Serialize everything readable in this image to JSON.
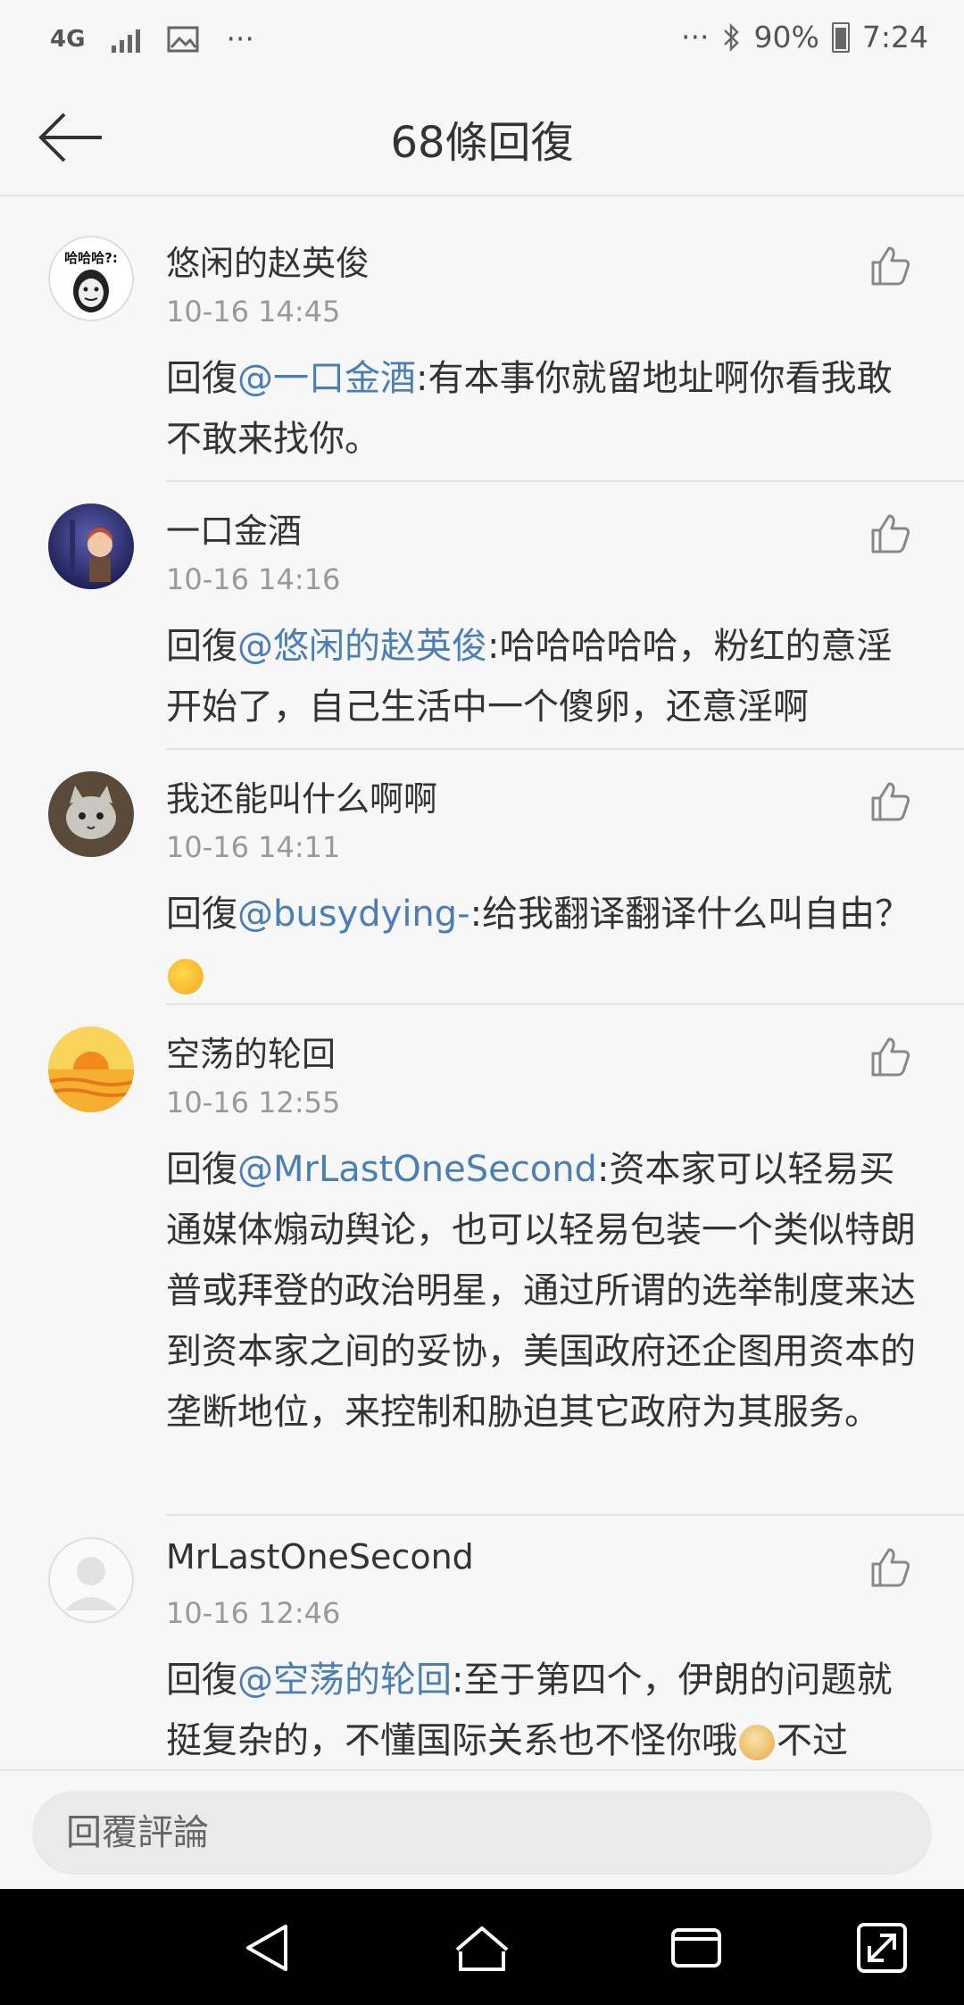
{
  "status_bar": {
    "network": "4G",
    "overflow": "···",
    "overflow_right": "···",
    "battery": "90%",
    "time": "7:24"
  },
  "header": {
    "title": "68條回復"
  },
  "reply_prefix": "回復",
  "comments": [
    {
      "username": "悠闲的赵英俊",
      "time": "10-16 14:45",
      "mention": "@一口金酒",
      "text": ":有本事你就留地址啊你看我敢不敢来找你。",
      "avatar_text": "哈哈哈?:"
    },
    {
      "username": "一口金酒",
      "time": "10-16 14:16",
      "mention": "@悠闲的赵英俊",
      "text": ":哈哈哈哈哈，粉红的意淫开始了，自己生活中一个傻卵，还意淫啊"
    },
    {
      "username": "我还能叫什么啊啊",
      "time": "10-16 14:11",
      "mention": "@busydying-",
      "text": ":给我翻译翻译什么叫自由？"
    },
    {
      "username": "空荡的轮回",
      "time": "10-16 12:55",
      "mention": "@MrLastOneSecond",
      "text": ":资本家可以轻易买通媒体煽动舆论，也可以轻易包装一个类似特朗普或拜登的政治明星，通过所谓的选举制度来达到资本家之间的妥协，美国政府还企图用资本的垄断地位，来控制和胁迫其它政府为其服务。"
    },
    {
      "username": "MrLastOneSecond",
      "time": "10-16 12:46",
      "mention": "@空荡的轮回",
      "text_a": ":至于第四个，伊朗的问题就挺复杂的，不懂国际关系也不怪你哦",
      "text_b": "不过"
    }
  ],
  "input": {
    "placeholder": "回覆評論"
  },
  "colors": {
    "mention": "#4a7eb7",
    "timestamp": "#999999",
    "nav_background": "#000000"
  },
  "icons": {
    "back": "arrow-left-icon",
    "like": "thumbs-up-icon",
    "nav_back": "triangle-back-icon",
    "nav_home": "home-icon",
    "nav_recents": "recents-icon",
    "nav_expand": "expand-icon"
  }
}
